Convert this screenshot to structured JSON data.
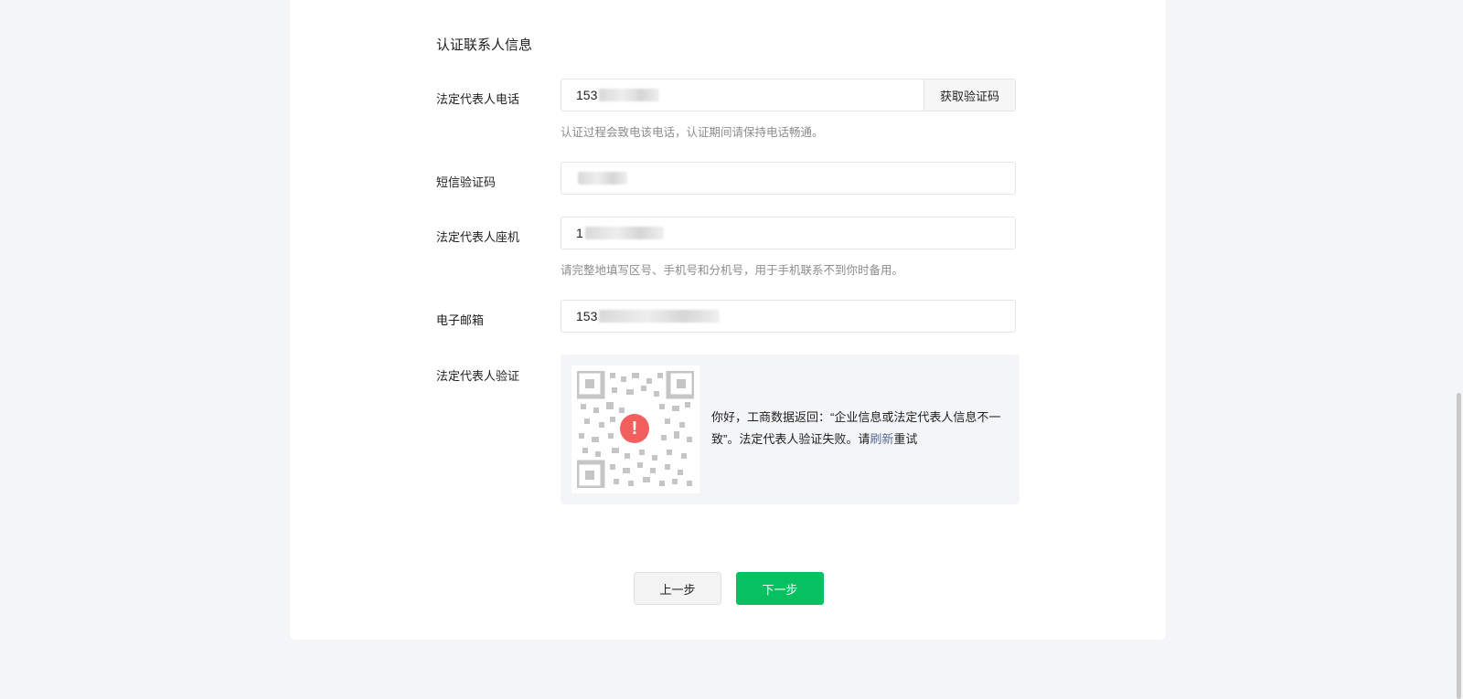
{
  "section": {
    "title": "认证联系人信息"
  },
  "fields": {
    "phone": {
      "label": "法定代表人电话",
      "value": "153",
      "button": "获取验证码",
      "hint": "认证过程会致电该电话，认证期间请保持电话畅通。"
    },
    "sms": {
      "label": "短信验证码",
      "value": ""
    },
    "landline": {
      "label": "法定代表人座机",
      "value": "1",
      "hint": "请完整地填写区号、手机号和分机号，用于手机联系不到你时备用。"
    },
    "email": {
      "label": "电子邮箱",
      "value": "153"
    }
  },
  "verification": {
    "label": "法定代表人验证",
    "warning_icon": "!",
    "message_part1": "你好，工商数据返回：“企业信息或法定代表人信息不一致”。法定代表人验证失败。请",
    "link_text": "刷新",
    "message_part2": "重试",
    "icons": {
      "qr": "qr-code-icon",
      "warning": "warning-icon"
    }
  },
  "actions": {
    "prev": "上一步",
    "next": "下一步"
  },
  "colors": {
    "primary": "#07c160",
    "error": "#f25f5c",
    "link": "#576b95"
  }
}
